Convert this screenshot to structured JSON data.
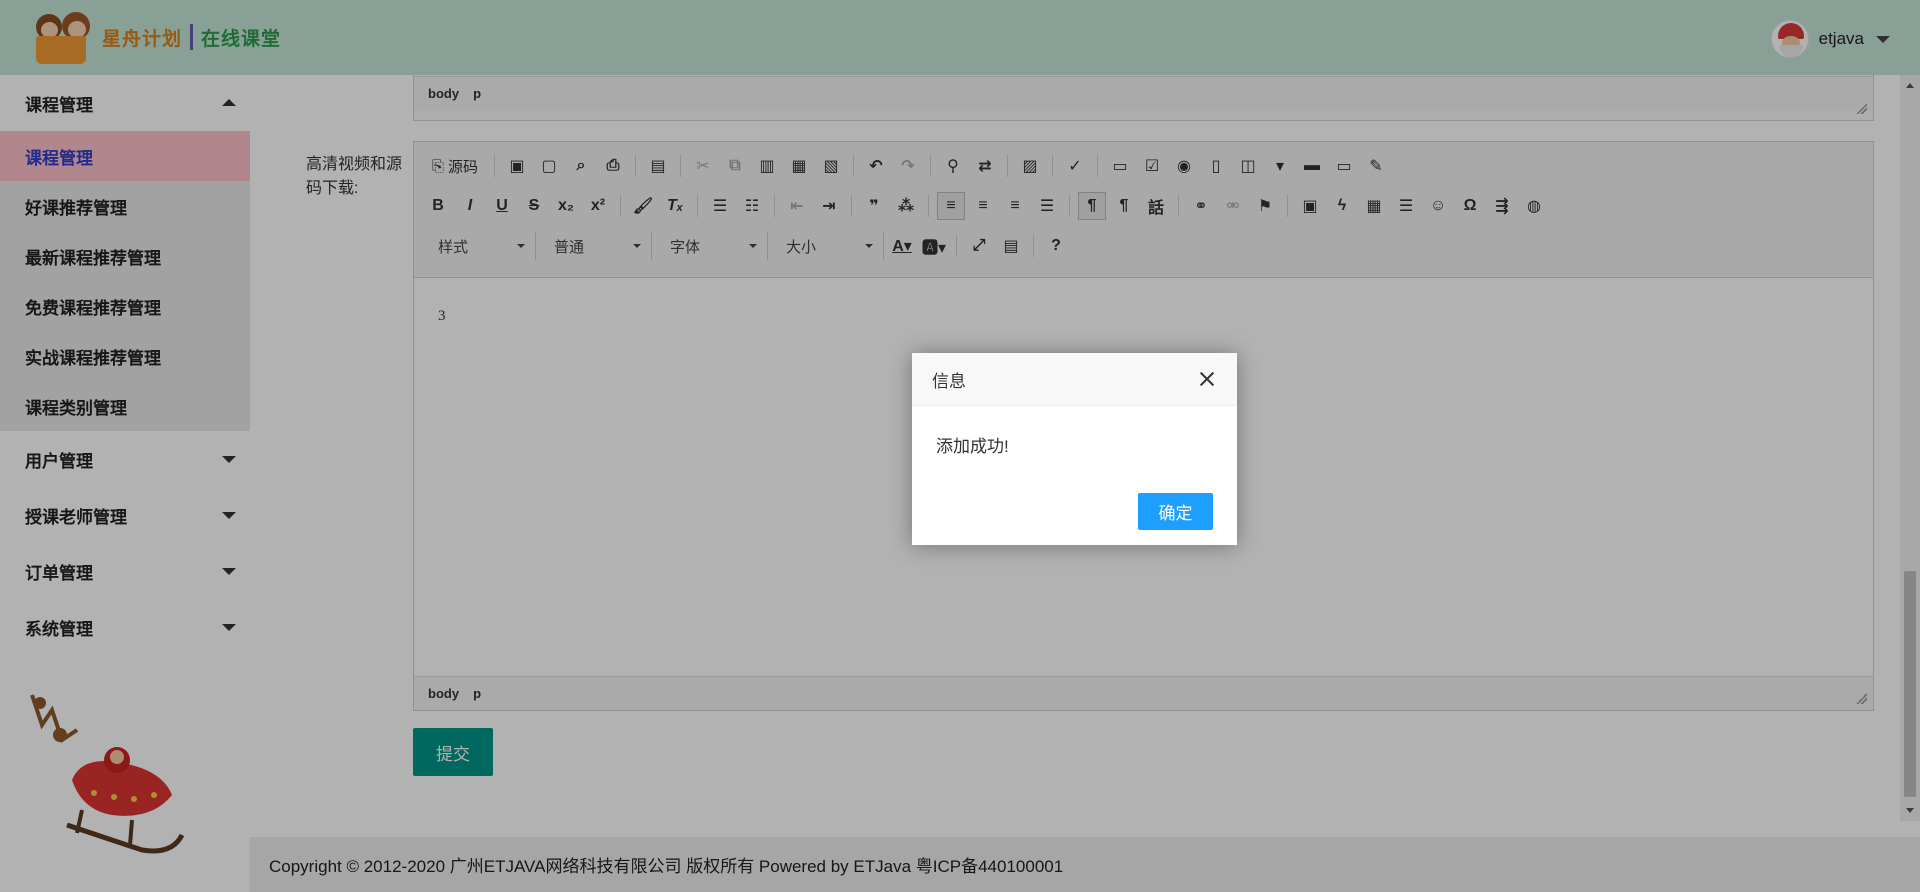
{
  "header": {
    "logo_text_1": "星舟计划",
    "logo_text_2": "在线课堂",
    "username": "etjava"
  },
  "sidebar": {
    "groups": [
      {
        "label": "课程管理",
        "expanded": true,
        "items": [
          {
            "label": "课程管理",
            "active": true
          },
          {
            "label": "好课推荐管理"
          },
          {
            "label": "最新课程推荐管理"
          },
          {
            "label": "免费课程推荐管理"
          },
          {
            "label": "实战课程推荐管理"
          },
          {
            "label": "课程类别管理"
          }
        ]
      },
      {
        "label": "用户管理",
        "expanded": false
      },
      {
        "label": "授课老师管理",
        "expanded": false
      },
      {
        "label": "订单管理",
        "expanded": false
      },
      {
        "label": "系统管理",
        "expanded": false
      }
    ]
  },
  "form": {
    "field_label": "高清视频和源码下载:",
    "editor_content": "3",
    "path_top": [
      "body",
      "p"
    ],
    "path_bottom": [
      "body",
      "p"
    ],
    "submit_label": "提交"
  },
  "editor_toolbar": {
    "source_label": "源码",
    "styles_combo": "样式",
    "format_combo": "普通",
    "font_combo": "字体",
    "size_combo": "大小"
  },
  "footer": {
    "copyright": "Copyright © 2012-2020 广州ETJAVA网络科技有限公司 版权所有 Powered by ETJava 粤ICP备440100001"
  },
  "dialog": {
    "title": "信息",
    "message": "添加成功!",
    "confirm_label": "确定"
  },
  "colors": {
    "header_bg": "#c3e5d6",
    "active_menu_bg": "#ffc0cb",
    "submit_btn": "#009688",
    "confirm_btn": "#1e9fff"
  }
}
